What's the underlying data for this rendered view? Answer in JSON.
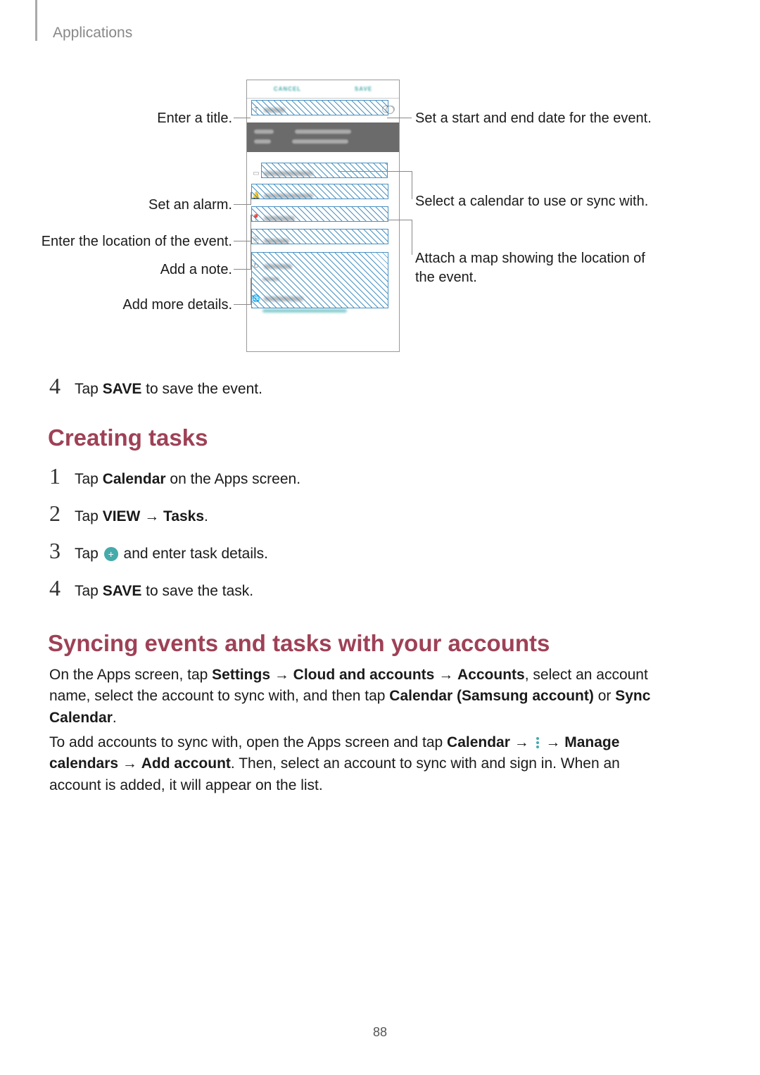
{
  "header": {
    "label": "Applications"
  },
  "figure": {
    "left_callouts": [
      "Enter a title.",
      "Set an alarm.",
      "Enter the location of the event.",
      "Add a note.",
      "Add more details."
    ],
    "right_callouts": [
      "Set a start and end date for the event.",
      "Select a calendar to use or sync with.",
      "Attach a map showing the location of the event."
    ],
    "shot_buttons": {
      "cancel": "CANCEL",
      "save": "SAVE"
    }
  },
  "step4_top": {
    "num": "4",
    "pre": "Tap ",
    "bold": "SAVE",
    "post": " to save the event."
  },
  "heading_tasks": "Creating tasks",
  "tasks_steps": [
    {
      "num": "1",
      "parts": [
        "Tap ",
        {
          "b": "Calendar"
        },
        " on the Apps screen."
      ]
    },
    {
      "num": "2",
      "parts": [
        "Tap ",
        {
          "b": "VIEW"
        },
        " → ",
        {
          "b": "Tasks"
        },
        "."
      ]
    },
    {
      "num": "3",
      "parts": [
        "Tap ",
        {
          "icon": "plus"
        },
        " and enter task details."
      ]
    },
    {
      "num": "4",
      "parts": [
        "Tap ",
        {
          "b": "SAVE"
        },
        " to save the task."
      ]
    }
  ],
  "heading_sync": "Syncing events and tasks with your accounts",
  "sync_para1": {
    "parts": [
      "On the Apps screen, tap ",
      {
        "b": "Settings"
      },
      " → ",
      {
        "b": "Cloud and accounts"
      },
      " → ",
      {
        "b": "Accounts"
      },
      ", select an account name, select the account to sync with, and then tap ",
      {
        "b": "Calendar (Samsung account)"
      },
      " or ",
      {
        "b": "Sync Calendar"
      },
      "."
    ]
  },
  "sync_para2": {
    "parts": [
      "To add accounts to sync with, open the Apps screen and tap ",
      {
        "b": "Calendar"
      },
      " → ",
      {
        "icon": "dots"
      },
      " → ",
      {
        "b": "Manage calendars"
      },
      " → ",
      {
        "b": "Add account"
      },
      ". Then, select an account to sync with and sign in. When an account is added, it will appear on the list."
    ]
  },
  "page_number": "88"
}
